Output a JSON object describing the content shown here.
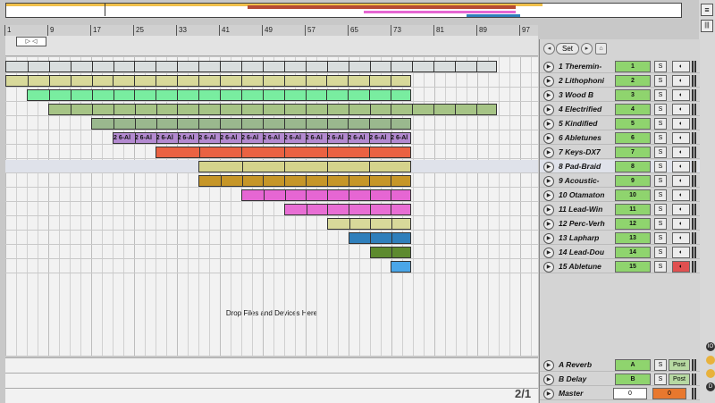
{
  "ruler": {
    "ticks": [
      "1",
      "9",
      "17",
      "25",
      "33",
      "41",
      "49",
      "57",
      "65",
      "73",
      "81",
      "89",
      "97"
    ]
  },
  "loop": {
    "bracket": "▷ ◁"
  },
  "tracks": [
    {
      "num": "1",
      "name": "1 Theremin-",
      "clip_label": "",
      "color": "#d9dede",
      "start": 0,
      "end": 550,
      "segs": 23,
      "rec_on": false
    },
    {
      "num": "2",
      "name": "2 Lithophoni",
      "clip_label": "",
      "color": "#d8d99a",
      "start": 0,
      "end": 454,
      "segs": 19,
      "rec_on": false
    },
    {
      "num": "3",
      "name": "3 Wood B",
      "clip_label": "",
      "color": "#79eda0",
      "start": 24,
      "end": 454,
      "segs": 18,
      "rec_on": false
    },
    {
      "num": "4",
      "name": "4 Electrified",
      "clip_label": "",
      "color": "#a6c486",
      "start": 48,
      "end": 550,
      "segs": 21,
      "rec_on": false
    },
    {
      "num": "5",
      "name": "5 Kindified",
      "clip_label": "",
      "color": "#9ab88e",
      "start": 96,
      "end": 454,
      "segs": 15,
      "rec_on": false
    },
    {
      "num": "6",
      "name": "6 Abletunes",
      "clip_label": "2 6-Al",
      "color": "#b38ad0",
      "start": 120,
      "end": 454,
      "segs": 14,
      "rec_on": false
    },
    {
      "num": "7",
      "name": "7 Keys-DX7",
      "clip_label": "",
      "color": "#ea6242",
      "start": 168,
      "end": 454,
      "segs": 6,
      "rec_on": false
    },
    {
      "num": "8",
      "name": "8 Pad-Braid",
      "clip_label": "",
      "color": "#d5d38c",
      "start": 216,
      "end": 454,
      "segs": 5,
      "rec_on": false
    },
    {
      "num": "9",
      "name": "9 Acoustic-",
      "clip_label": "",
      "color": "#c69628",
      "start": 216,
      "end": 454,
      "segs": 10,
      "rec_on": false
    },
    {
      "num": "10",
      "name": "10 Otamaton",
      "clip_label": "",
      "color": "#e666d3",
      "start": 264,
      "end": 454,
      "segs": 8,
      "rec_on": false
    },
    {
      "num": "11",
      "name": "11 Lead-Win",
      "clip_label": "",
      "color": "#e86ed4",
      "start": 312,
      "end": 454,
      "segs": 6,
      "rec_on": false
    },
    {
      "num": "12",
      "name": "12 Perc-Verh",
      "clip_label": "",
      "color": "#d8d99a",
      "start": 360,
      "end": 454,
      "segs": 4,
      "rec_on": false
    },
    {
      "num": "13",
      "name": "13 Lapharp",
      "clip_label": "",
      "color": "#2f7fbb",
      "start": 384,
      "end": 454,
      "segs": 3,
      "rec_on": false
    },
    {
      "num": "14",
      "name": "14 Lead-Dou",
      "clip_label": "",
      "color": "#5d8a2e",
      "start": 408,
      "end": 454,
      "segs": 2,
      "rec_on": false
    },
    {
      "num": "15",
      "name": "15 Abletune",
      "clip_label": "",
      "color": "#4aa6e8",
      "start": 431,
      "end": 454,
      "segs": 1,
      "rec_on": true
    }
  ],
  "arrangement": {
    "drop_hint": "Drop Files and Devices Here"
  },
  "returns": [
    {
      "name": "A Reverb",
      "label": "A",
      "post": "Post"
    },
    {
      "name": "B Delay",
      "label": "B",
      "post": "Post"
    }
  ],
  "master": {
    "name": "Master",
    "vol_left": "0",
    "vol_right": "0"
  },
  "counter": "2/1",
  "mixer": {
    "set_label": "Set",
    "solo": "S"
  },
  "colors": {
    "track_num_bg": "#8fd46e",
    "rec_on": "#e05050",
    "selected_row": "#dfe2ea"
  }
}
